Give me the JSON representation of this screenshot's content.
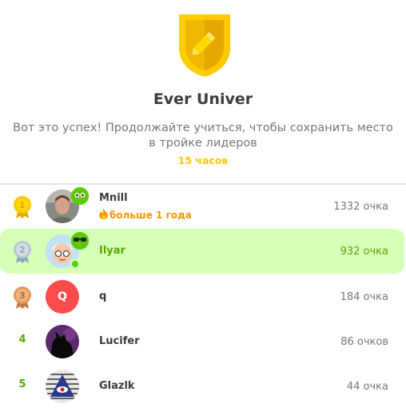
{
  "league": {
    "title": "Ever Univer",
    "subtitle": "Вот это успех! Продолжайте учиться, чтобы сохранить место в тройке лидеров",
    "time_left": "15 часов",
    "icon": "shield-pencil-icon"
  },
  "leaderboard": [
    {
      "rank": "1",
      "name": "Mnill",
      "xp": "1332 очка",
      "streak": "больше 1 года",
      "avatar": "photo",
      "medal": "gold"
    },
    {
      "rank": "2",
      "name": "Ilyar",
      "xp": "932 очка",
      "avatar": "cartoon",
      "medal": "silver",
      "current_user": true
    },
    {
      "rank": "3",
      "name": "q",
      "xp": "184 очка",
      "avatar_letter": "Q",
      "medal": "bronze"
    },
    {
      "rank": "4",
      "name": "Lucifer",
      "xp": "86 очков",
      "avatar": "dark"
    },
    {
      "rank": "5",
      "name": "Glazlk",
      "xp": "44 очка",
      "avatar": "eye-pyramid"
    }
  ],
  "colors": {
    "accent_green": "#58a700",
    "highlight": "#d7ffb8",
    "gold": "#ffc800",
    "streak": "#ff9600"
  }
}
